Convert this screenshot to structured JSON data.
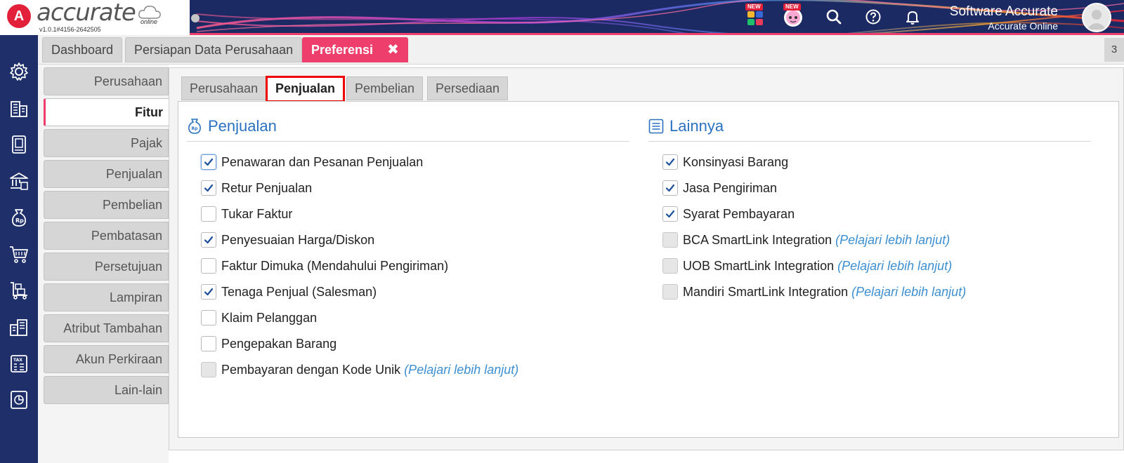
{
  "header": {
    "brand": "accurate",
    "online_label": "online",
    "version": "v1.0.1#4156-2642505",
    "new_badge": "NEW",
    "user_name": "Software Accurate",
    "user_company": "Accurate Online",
    "colors": {
      "accent": "#ee3e6b",
      "bar": "#1b2a63"
    }
  },
  "tabs": [
    {
      "label": "Dashboard"
    },
    {
      "label": "Persiapan Data Perusahaan"
    },
    {
      "label": "Preferensi",
      "active": true
    }
  ],
  "tab_close": "✖",
  "tab_count": "3",
  "side_menu": [
    "Perusahaan",
    "Fitur",
    "Pajak",
    "Penjualan",
    "Pembelian",
    "Pembatasan",
    "Persetujuan",
    "Lampiran",
    "Atribut Tambahan",
    "Akun Perkiraan",
    "Lain-lain"
  ],
  "side_menu_active": "Fitur",
  "sub_tabs": [
    "Perusahaan",
    "Penjualan",
    "Pembelian",
    "Persediaan"
  ],
  "sub_tab_active": "Penjualan",
  "learn_more": "(Pelajari lebih lanjut)",
  "sections": {
    "penjualan": {
      "title": "Penjualan",
      "options": [
        {
          "label": "Penawaran dan Pesanan Penjualan",
          "checked": true
        },
        {
          "label": "Retur Penjualan",
          "checked": true
        },
        {
          "label": "Tukar Faktur",
          "checked": false
        },
        {
          "label": "Penyesuaian Harga/Diskon",
          "checked": true
        },
        {
          "label": "Faktur Dimuka (Mendahului Pengiriman)",
          "checked": false
        },
        {
          "label": "Tenaga Penjual (Salesman)",
          "checked": true
        },
        {
          "label": "Klaim Pelanggan",
          "checked": false
        },
        {
          "label": "Pengepakan Barang",
          "checked": false
        },
        {
          "label": "Pembayaran dengan Kode Unik",
          "checked": false,
          "disabled": true
        }
      ]
    },
    "lainnya": {
      "title": "Lainnya",
      "options": [
        {
          "label": "Konsinyasi Barang",
          "checked": true
        },
        {
          "label": "Jasa Pengiriman",
          "checked": true
        },
        {
          "label": "Syarat Pembayaran",
          "checked": true
        },
        {
          "label": "BCA SmartLink Integration",
          "checked": false,
          "disabled": true
        },
        {
          "label": "UOB SmartLink Integration",
          "checked": false,
          "disabled": true
        },
        {
          "label": "Mandiri SmartLink Integration",
          "checked": false,
          "disabled": true
        }
      ]
    }
  }
}
